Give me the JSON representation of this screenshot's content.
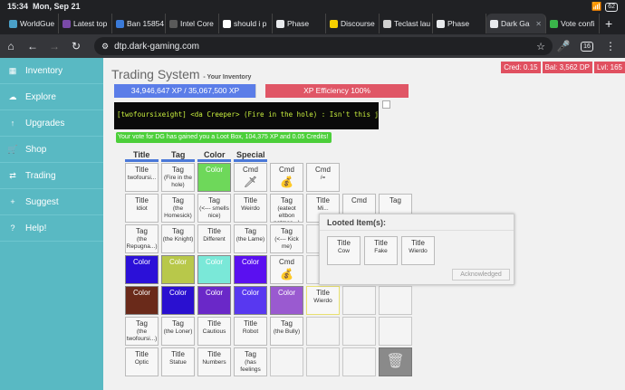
{
  "status": {
    "time": "15:34",
    "date": "Mon, Sep 21",
    "battery": "62"
  },
  "tabs": [
    {
      "label": "WorldGue",
      "color": "#4aa0c8",
      "icon": "globe-favicon"
    },
    {
      "label": "Latest top",
      "color": "#7a4aa8",
      "icon": "forum-favicon"
    },
    {
      "label": "Ban 15854",
      "color": "#3a7ad8",
      "icon": "ban-favicon"
    },
    {
      "label": "Intel Core",
      "color": "#5a5a5a",
      "icon": "doc-favicon"
    },
    {
      "label": "should i p",
      "color": "#ffffff",
      "icon": "google-favicon"
    },
    {
      "label": "Phase",
      "color": "#e8eaed",
      "icon": "phase-favicon"
    },
    {
      "label": "Discourse",
      "color": "#f5d000",
      "icon": "discourse-favicon"
    },
    {
      "label": "Teclast lau",
      "color": "#d0d0d0",
      "icon": "doc-favicon"
    },
    {
      "label": "Phase",
      "color": "#e8eaed",
      "icon": "phase-favicon"
    },
    {
      "label": "Dark Ga",
      "color": "#e8eaed",
      "icon": "phase-favicon",
      "active": true
    },
    {
      "label": "Vote confi",
      "color": "#3ab54a",
      "icon": "vote-favicon"
    }
  ],
  "url": "dtp.dark-gaming.com",
  "tab_count": "16",
  "sidebar": [
    {
      "label": "Inventory",
      "icon": "▦"
    },
    {
      "label": "Explore",
      "icon": "☁"
    },
    {
      "label": "Upgrades",
      "icon": "↑"
    },
    {
      "label": "Shop",
      "icon": "🛒"
    },
    {
      "label": "Trading",
      "icon": "⇄"
    },
    {
      "label": "Suggest",
      "icon": "+"
    },
    {
      "label": "Help!",
      "icon": "?"
    }
  ],
  "header": {
    "title": "Trading System",
    "subtitle": "- Your Inventory",
    "credits": "Cred: 0.15",
    "balance": "Bal: 3,562 DP",
    "level": "Lvl: 165"
  },
  "xp": {
    "text": "34,946,647 XP / 35,067,500 XP",
    "fraction": 0.9966,
    "efficiency": "XP Efficiency 100%"
  },
  "banner": "[twofoursixeight] <da Creeper> (Fire in the hole) : Isn't this just the best?",
  "vote_message": "Your vote for DG has gained you a Loot Box, 104,375 XP and 0.05 Credits!",
  "columns": [
    "Title",
    "Tag",
    "Color",
    "Special"
  ],
  "inventory": [
    [
      {
        "type": "Title",
        "sub": "twofoursi..."
      },
      {
        "type": "Tag",
        "sub": "(Fire in the hole)"
      },
      {
        "type": "Color",
        "sub": "",
        "color": "#6ed85a"
      },
      {
        "type": "Cmd",
        "sub": "",
        "emoji": "🗡"
      },
      {
        "type": "Cmd",
        "sub": "",
        "emoji": "💰"
      },
      {
        "type": "Cmd",
        "sub": "/="
      }
    ],
    [
      {
        "type": "Title",
        "sub": "Idiot"
      },
      {
        "type": "Tag",
        "sub": "(the Homesick)"
      },
      {
        "type": "Tag",
        "sub": "(<--- smells nice)"
      },
      {
        "type": "Title",
        "sub": "Weirdo"
      },
      {
        "type": "Tag",
        "sub": "(eateot eltbon natmos...)"
      },
      {
        "type": "Title",
        "sub": "Mi..."
      },
      {
        "type": "Cmd",
        "sub": ""
      },
      {
        "type": "Tag",
        "sub": ""
      }
    ],
    [
      {
        "type": "Tag",
        "sub": "(the Repugna...)"
      },
      {
        "type": "Tag",
        "sub": "(the Knight)"
      },
      {
        "type": "Title",
        "sub": "Different"
      },
      {
        "type": "Tag",
        "sub": "(the Lame)"
      },
      {
        "type": "Tag",
        "sub": "(<--- Kick me)"
      },
      {
        "type": "",
        "sub": ""
      },
      {
        "type": "",
        "sub": ""
      },
      {
        "type": "",
        "sub": ""
      }
    ],
    [
      {
        "type": "Color",
        "sub": "",
        "color": "#2b10d8"
      },
      {
        "type": "Color",
        "sub": "",
        "color": "#b8c84a"
      },
      {
        "type": "Color",
        "sub": "",
        "color": "#7ae8d8"
      },
      {
        "type": "Color",
        "sub": "",
        "color": "#5a10f0"
      },
      {
        "type": "Cmd",
        "sub": "",
        "emoji": "💰"
      },
      {
        "type": "",
        "sub": ""
      },
      {
        "type": "",
        "sub": ""
      },
      {
        "type": "",
        "sub": ""
      }
    ],
    [
      {
        "type": "Color",
        "sub": "",
        "color": "#6a2a1a"
      },
      {
        "type": "Color",
        "sub": "",
        "color": "#2a10d0"
      },
      {
        "type": "Color",
        "sub": "",
        "color": "#6a28c8"
      },
      {
        "type": "Color",
        "sub": "",
        "color": "#5838f0"
      },
      {
        "type": "Color",
        "sub": "",
        "color": "#9a5ad0"
      },
      {
        "type": "Title",
        "sub": "Wierdo",
        "selected": true
      },
      {
        "type": "",
        "sub": ""
      },
      {
        "type": "",
        "sub": ""
      }
    ],
    [
      {
        "type": "Tag",
        "sub": "(the twofoursi...)"
      },
      {
        "type": "Tag",
        "sub": "(the Loner)"
      },
      {
        "type": "Title",
        "sub": "Cautious"
      },
      {
        "type": "Title",
        "sub": "Robot"
      },
      {
        "type": "Tag",
        "sub": "(the Bully)"
      },
      {
        "type": "",
        "sub": ""
      },
      {
        "type": "",
        "sub": ""
      },
      {
        "type": "",
        "sub": ""
      }
    ],
    [
      {
        "type": "Title",
        "sub": "Optic"
      },
      {
        "type": "Title",
        "sub": "Statue"
      },
      {
        "type": "Title",
        "sub": "Numbers"
      },
      {
        "type": "Tag",
        "sub": "(has feelings"
      },
      {
        "type": "",
        "sub": ""
      },
      {
        "type": "",
        "sub": ""
      },
      {
        "type": "",
        "sub": ""
      },
      {
        "type": "trash",
        "sub": "🗑"
      }
    ]
  ],
  "popup": {
    "title": "Looted Item(s):",
    "items": [
      {
        "type": "Title",
        "sub": "Cow"
      },
      {
        "type": "Title",
        "sub": "Fake"
      },
      {
        "type": "Title",
        "sub": "Wierdo"
      }
    ],
    "button": "Acknowledged"
  }
}
